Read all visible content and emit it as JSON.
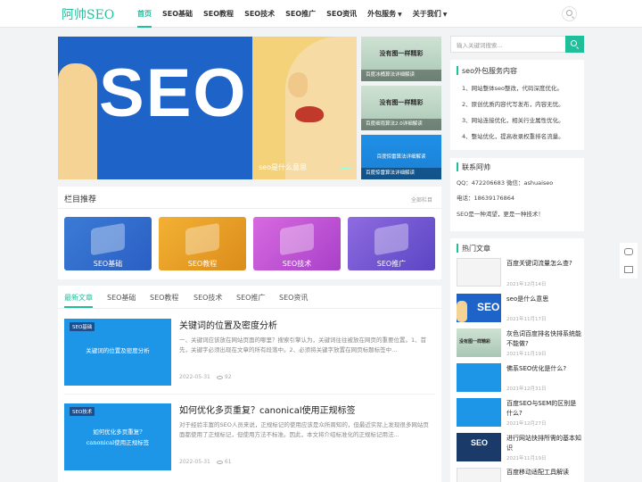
{
  "header": {
    "logo": "阿帅SEO",
    "nav": [
      "首页",
      "SEO基础",
      "SEO教程",
      "SEO技术",
      "SEO推广",
      "SEO资讯",
      "外包服务",
      "关于我们"
    ]
  },
  "hero": {
    "seo_text": "SEO",
    "caption": "seo是什么意思",
    "thumbs": [
      {
        "text": "没有图一样精彩",
        "caption": "百度冰桶算法详细解读"
      },
      {
        "text": "没有图一样精彩",
        "caption": "百度细雨算法2.0详细解读"
      },
      {
        "text": "百度惊雷算法详细解读",
        "caption": "百度惊雷算法详细解读"
      }
    ]
  },
  "columns": {
    "title": "栏目推荐",
    "more": "全部栏目",
    "items": [
      "SEO基础",
      "SEO教程",
      "SEO技术",
      "SEO推广"
    ]
  },
  "tabs": [
    "最新文章",
    "SEO基础",
    "SEO教程",
    "SEO技术",
    "SEO推广",
    "SEO资讯"
  ],
  "articles": [
    {
      "tag": "SEO基础",
      "img_text": "关键词的位置及密度分析",
      "title": "关键词的位置及密度分析",
      "excerpt": "一、关键词应该放在网站页面的哪里？搜索引擎认为，关键词往往被放在网页的重要位置。1、首先，关键字必须出现在文章的所有段落中。2、必须将关键字放置在网页标题标签中...",
      "date": "2022-05-31",
      "views": "92"
    },
    {
      "tag": "SEO技术",
      "img_text1": "如何优化多页重复?",
      "img_text2": "canonical使用正规标签",
      "title": "如何优化多页重复？canonical使用正规标签",
      "excerpt": "对于经验丰富的SEO人员来说，正规标记的使用应该是众所周知的，但最近实际上发现很多网站页面都使用了正规标记，但使用方法不标准。因此，本文将介绍标准化的正规标记用法...",
      "date": "2022-05-31",
      "views": "61"
    }
  ],
  "sidebar": {
    "search_placeholder": "输入关键词搜索...",
    "services_title": "seo外包服务内容",
    "services": [
      "1、网站整体seo整改，代码深度优化。",
      "2、原创优质内容代写发布，内容无忧。",
      "3、网站连接优化，相关行业属性优化。",
      "4、整站优化，提高收录权重排名流量。"
    ],
    "contact_title": "联系阿帅",
    "contact": [
      "QQ：472206683 微信：ashuaiseo",
      "电话：18639176864",
      "SEO是一种渴望，更是一种技术！"
    ],
    "hot_title": "热门文章",
    "hot": [
      {
        "title": "百度关键词流量怎么查?",
        "date": "2021年12月14日"
      },
      {
        "title": "seo是什么意思",
        "date": "2021年11月17日",
        "img_text": "SEO"
      },
      {
        "title": "灰色词百度排名快排系统能不能做?",
        "date": "2021年11月19日",
        "img_text": "没有图一样精彩"
      },
      {
        "title": "佛系SEO优化是什么?",
        "date": "2021年12月31日"
      },
      {
        "title": "百度SEO与SEM的区别是什么?",
        "date": "2021年12月27日"
      },
      {
        "title": "进行网站快排所需的基本知识",
        "date": "2021年11月19日",
        "img_text": "SEO"
      },
      {
        "title": "百度移动适配工具解读",
        "date": ""
      }
    ]
  },
  "colors": {
    "accent": "#1fbf9a",
    "blue": "#1e96e8"
  }
}
